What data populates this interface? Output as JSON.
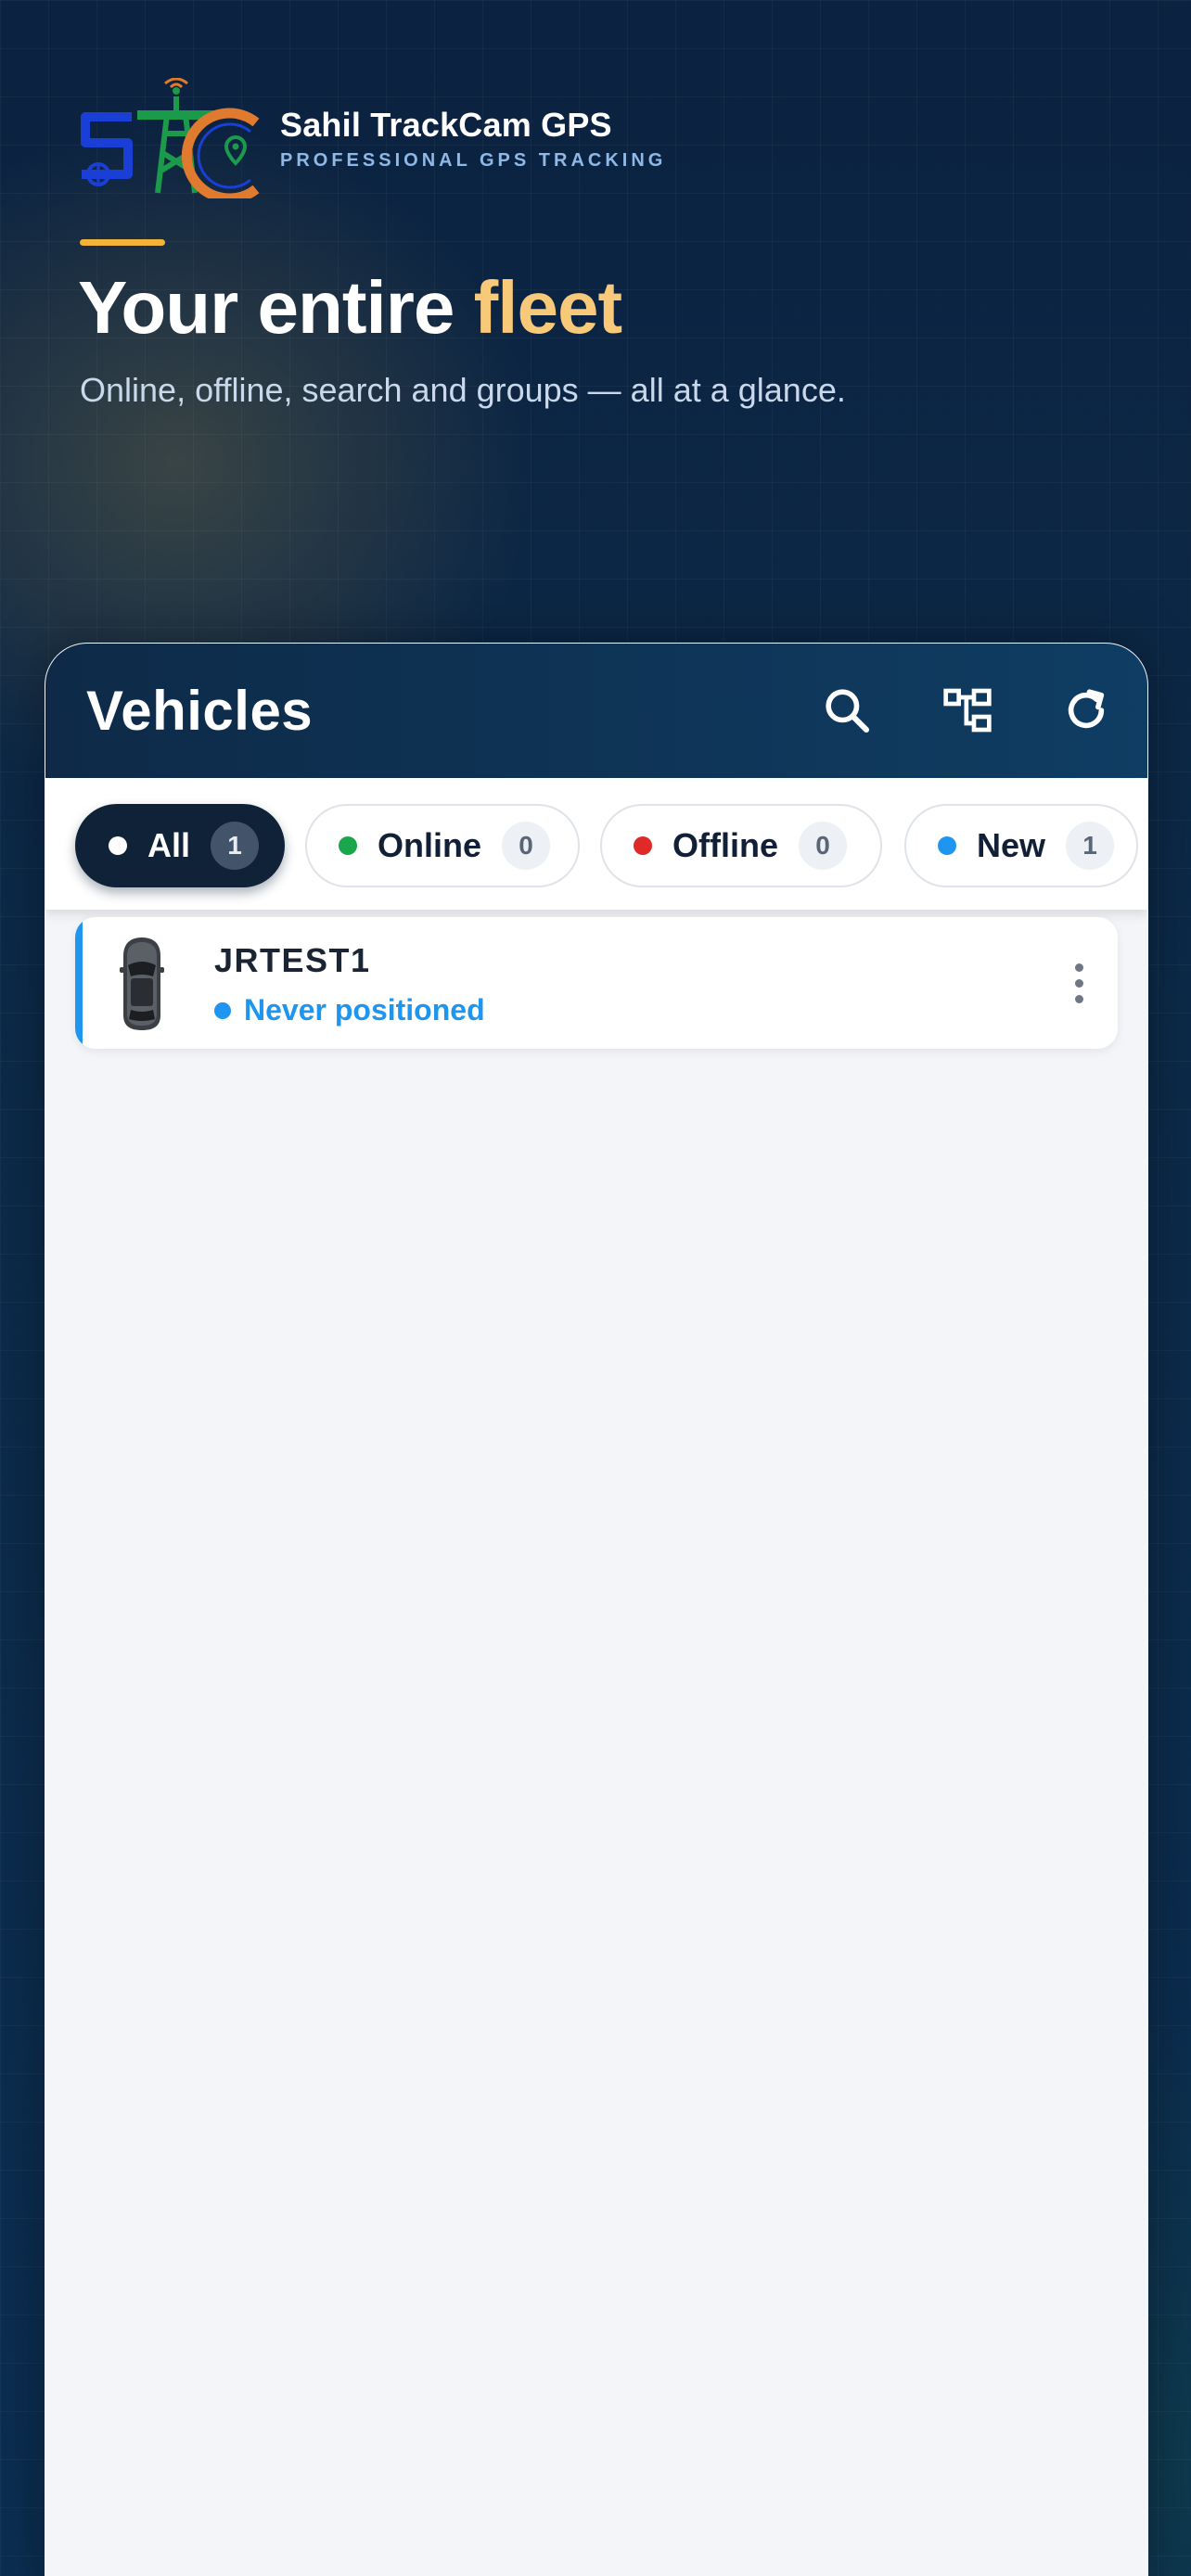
{
  "brand": {
    "name": "Sahil TrackCam GPS",
    "tagline": "PROFESSIONAL GPS TRACKING",
    "logo_icon": "stc-tower-logo"
  },
  "hero": {
    "title_main": "Your entire",
    "title_highlight": "fleet",
    "subtitle": "Online, offline, search and groups — all at a glance."
  },
  "panel": {
    "title": "Vehicles",
    "actions": {
      "search_icon": "search-icon",
      "groups_icon": "hierarchy-icon",
      "refresh_icon": "refresh-icon"
    }
  },
  "filters": [
    {
      "label": "All",
      "count": "1",
      "selected": true,
      "dot_color": "#ffffff"
    },
    {
      "label": "Online",
      "count": "0",
      "selected": false,
      "dot_color": "#1aa64a"
    },
    {
      "label": "Offline",
      "count": "0",
      "selected": false,
      "dot_color": "#e02a2a"
    },
    {
      "label": "New",
      "count": "1",
      "selected": false,
      "dot_color": "#1e96f0"
    }
  ],
  "vehicles": [
    {
      "name": "JRTEST1",
      "status": "Never positioned",
      "status_color": "#1e96f0",
      "icon": "car-topview-icon"
    }
  ],
  "colors": {
    "accent": "#f3b23a",
    "highlight": "#f9c97a",
    "header_dark": "#0e2a48",
    "new_blue": "#1e96f0"
  }
}
